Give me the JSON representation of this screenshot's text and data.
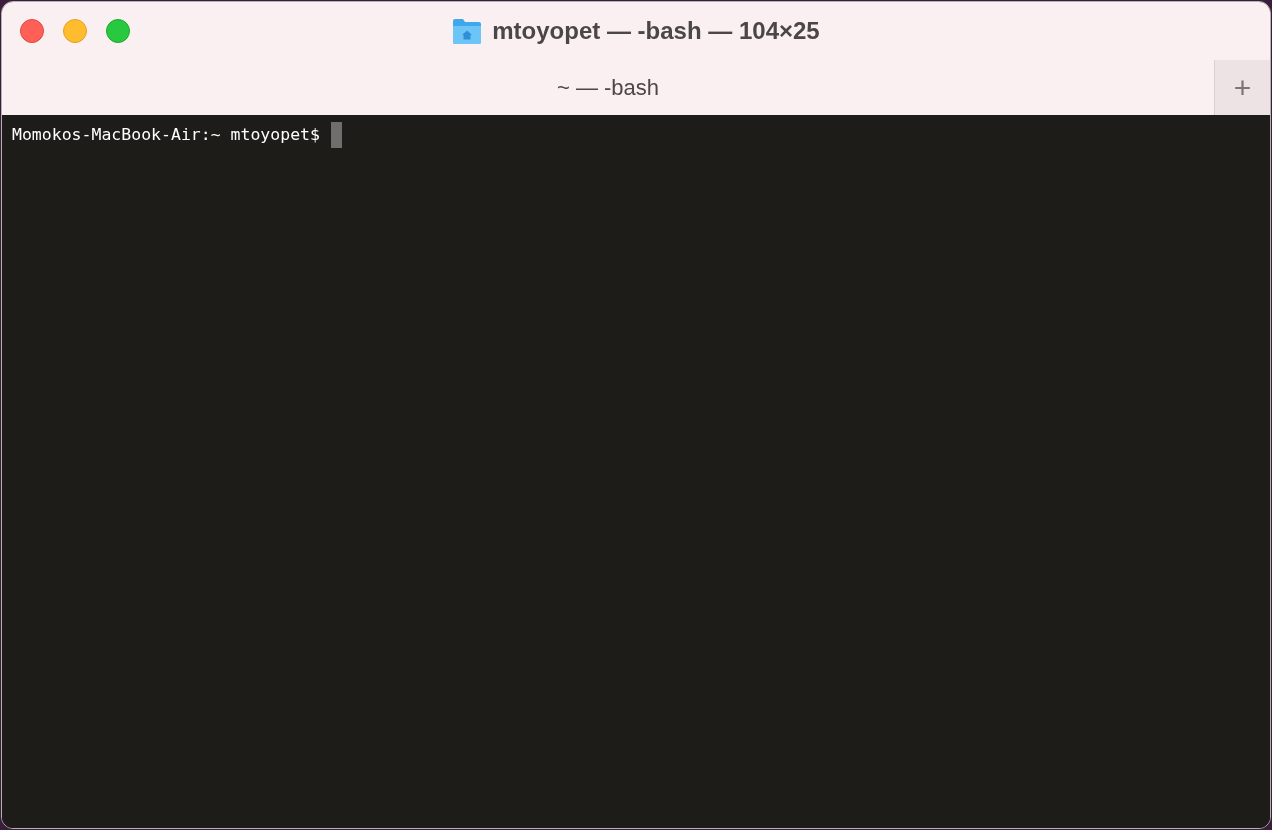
{
  "window": {
    "title": "mtoyopet — -bash — 104×25"
  },
  "tabs": [
    {
      "label": "~ — -bash",
      "selected": true
    }
  ],
  "new_tab_button": "+",
  "terminal": {
    "lines": [
      {
        "prompt": "Momokos-MacBook-Air:~ mtoyopet$",
        "cursor": true
      }
    ]
  }
}
